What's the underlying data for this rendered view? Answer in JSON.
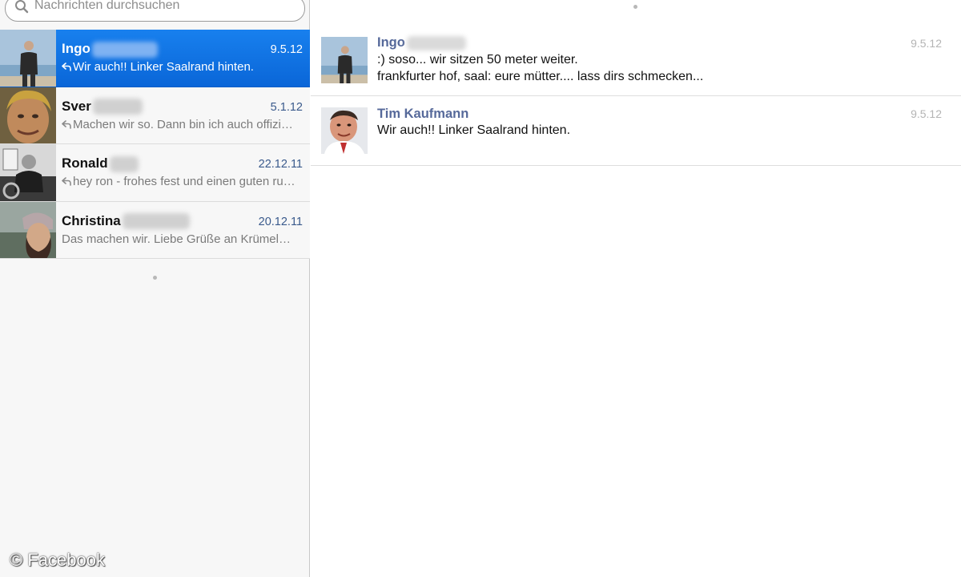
{
  "search": {
    "placeholder": "Nachrichten durchsuchen"
  },
  "conversations": [
    {
      "name": "Ingo",
      "date": "9.5.12",
      "preview": "Wir auch!! Linker Saalrand hinten.",
      "replied": true,
      "selected": true
    },
    {
      "name": "Sver",
      "date": "5.1.12",
      "preview": "Machen wir so. Dann bin ich auch offizi…",
      "replied": true,
      "selected": false
    },
    {
      "name": "Ronald",
      "date": "22.12.11",
      "preview": "hey ron - frohes fest und einen guten ru…",
      "replied": true,
      "selected": false
    },
    {
      "name": "Christina",
      "date": "20.12.11",
      "preview": "Das machen wir. Liebe Grüße an Krümel…",
      "replied": false,
      "selected": false
    }
  ],
  "messages": [
    {
      "sender": "Ingo",
      "date": "9.5.12",
      "lines": [
        ":) soso... wir sitzen 50 meter weiter.",
        "frankfurter hof, saal: eure mütter.... lass dirs schmecken..."
      ]
    },
    {
      "sender": "Tim Kaufmann",
      "date": "9.5.12",
      "lines": [
        "Wir auch!! Linker Saalrand hinten."
      ]
    }
  ],
  "watermark": "© Facebook",
  "colors": {
    "selected": "#0a66d8",
    "sender_name": "#56699a",
    "date": "#3a5a8c"
  }
}
